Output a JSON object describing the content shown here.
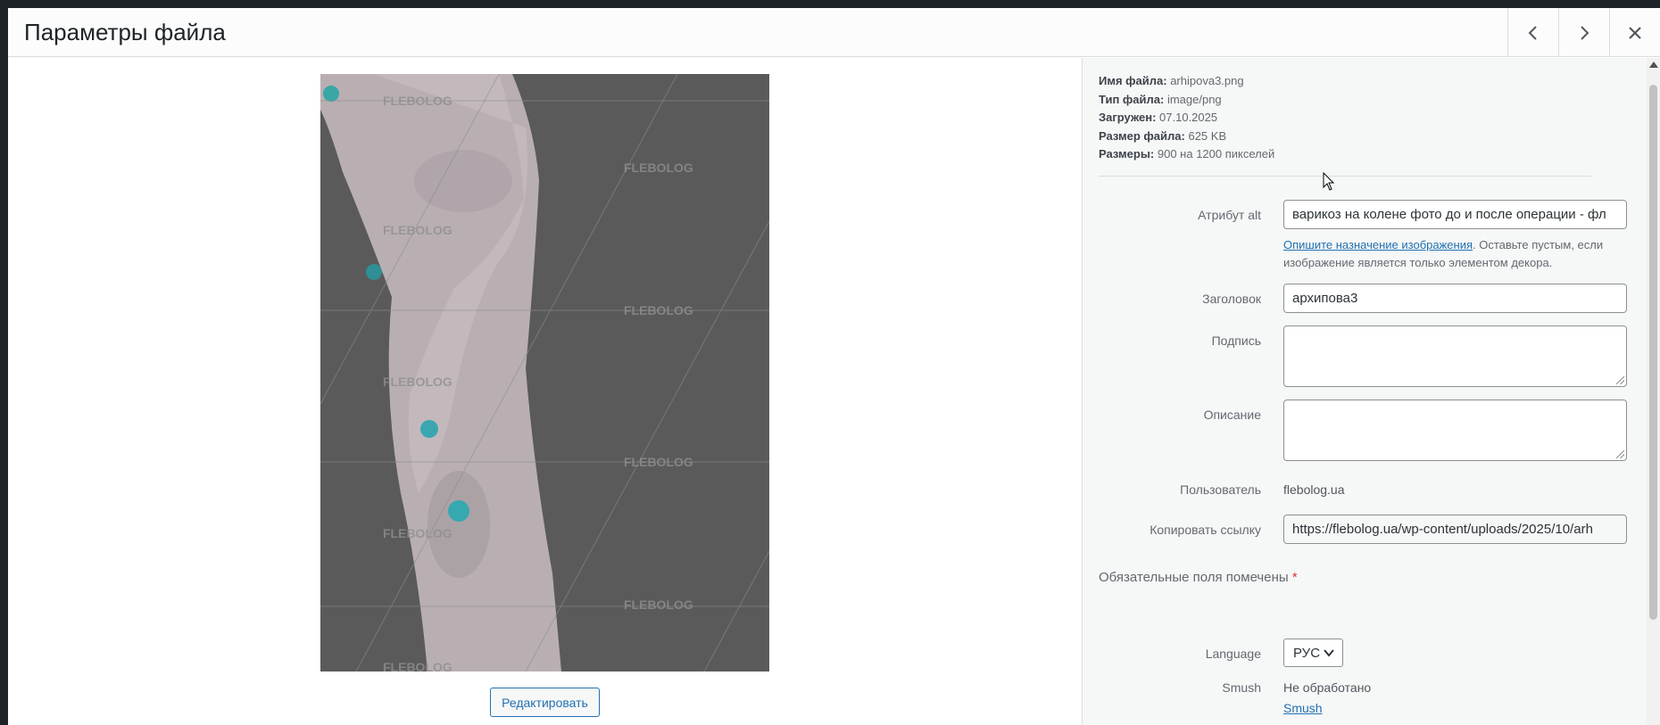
{
  "header": {
    "title": "Параметры файла",
    "prev_icon": "chevron-left-icon",
    "next_icon": "chevron-right-icon",
    "close_icon": "close-icon"
  },
  "preview": {
    "watermark": "FLEBOLOG",
    "edit_label": "Редактировать"
  },
  "meta": [
    {
      "label": "Имя файла:",
      "value": "arhipova3.png"
    },
    {
      "label": "Тип файла:",
      "value": "image/png"
    },
    {
      "label": "Загружен:",
      "value": "07.10.2025"
    },
    {
      "label": "Размер файла:",
      "value": "625 KB"
    },
    {
      "label": "Размеры:",
      "value": "900 на 1200 пикселей"
    }
  ],
  "form": {
    "alt_label": "Атрибут alt",
    "alt_value": "варикоз на колене фото до и после операции - фл",
    "alt_help_link": "Опишите назначение изображения",
    "alt_help_text": ". Оставьте пустым, если изображение является только элементом декора.",
    "title_label": "Заголовок",
    "title_value": "архипова3",
    "caption_label": "Подпись",
    "caption_value": "",
    "description_label": "Описание",
    "description_value": "",
    "user_label": "Пользователь",
    "user_value": "flebolog.ua",
    "copy_label": "Копировать ссылку",
    "copy_value": "https://flebolog.ua/wp-content/uploads/2025/10/arh",
    "required_text": "Обязательные поля помечены",
    "required_star": "*",
    "language_label": "Language",
    "language_value": "РУС",
    "smush_label": "Smush",
    "smush_status": "Не обработано",
    "smush_link": "Smush"
  },
  "colors": {
    "accent": "#2271b1",
    "required": "#d63638",
    "photo_bg": "#5a5a5a"
  }
}
